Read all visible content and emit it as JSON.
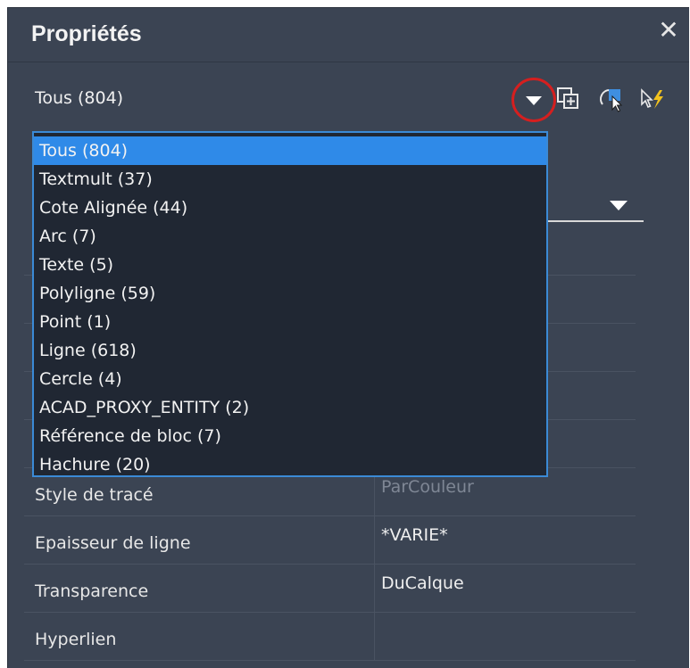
{
  "panel": {
    "title": "Propriétés",
    "close_icon": "close-icon"
  },
  "selector": {
    "value": "Tous (804)",
    "toolbar_icons": [
      "toggle-pickadd-icon",
      "select-objects-icon",
      "quick-select-icon"
    ]
  },
  "dropdown": {
    "items": [
      {
        "label": "Tous (804)",
        "selected": true
      },
      {
        "label": "Textmult (37)"
      },
      {
        "label": "Cote Alignée (44)"
      },
      {
        "label": "Arc (7)"
      },
      {
        "label": "Texte (5)"
      },
      {
        "label": "Polyligne (59)"
      },
      {
        "label": "Point (1)"
      },
      {
        "label": "Ligne (618)"
      },
      {
        "label": "Cercle (4)"
      },
      {
        "label": "ACAD_PROXY_ENTITY (2)"
      },
      {
        "label": "Référence de bloc (7)"
      },
      {
        "label": "Hachure (20)"
      }
    ]
  },
  "properties": {
    "rows": [
      {
        "name": "Style de tracé",
        "value": "ParCouleur"
      },
      {
        "name": "Epaisseur de ligne",
        "value": "*VARIE*"
      },
      {
        "name": "Transparence",
        "value": "DuCalque"
      },
      {
        "name": "Hyperlien",
        "value": ""
      }
    ]
  },
  "colors": {
    "panel_bg": "#3b4453",
    "dropdown_bg": "#202733",
    "selected_item": "#2f8ae8",
    "highlight_circle": "#d51f1f"
  }
}
